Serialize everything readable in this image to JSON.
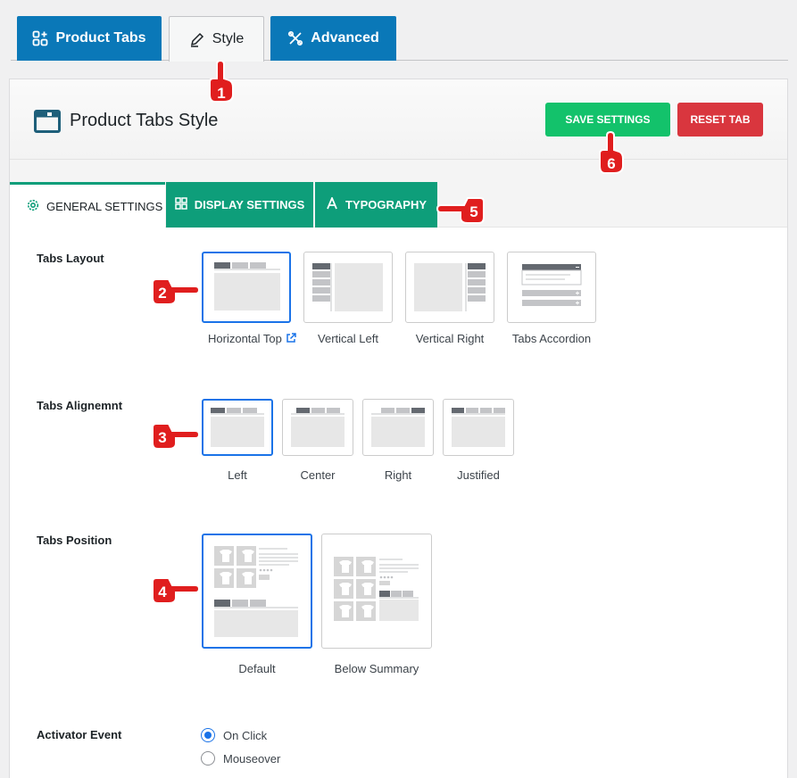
{
  "top_tabs": [
    {
      "label": "Product Tabs",
      "icon": "grid-plus-icon"
    },
    {
      "label": "Style",
      "icon": "pen-icon"
    },
    {
      "label": "Advanced",
      "icon": "tools-icon"
    }
  ],
  "header": {
    "title": "Product Tabs Style",
    "save_label": "SAVE SETTINGS",
    "reset_label": "RESET TAB"
  },
  "sub_tabs": [
    {
      "label": "GENERAL SETTINGS",
      "icon": "gear-icon"
    },
    {
      "label": "DISPLAY SETTINGS",
      "icon": "grid-icon"
    },
    {
      "label": "TYPOGRAPHY",
      "icon": "font-icon"
    }
  ],
  "fields": {
    "layout": {
      "label": "Tabs Layout",
      "options": [
        "Horizontal Top",
        "Vertical Left",
        "Vertical Right",
        "Tabs Accordion"
      ],
      "selected": "Horizontal Top"
    },
    "alignment": {
      "label": "Tabs Alignemnt",
      "options": [
        "Left",
        "Center",
        "Right",
        "Justified"
      ],
      "selected": "Left"
    },
    "position": {
      "label": "Tabs Position",
      "options": [
        "Default",
        "Below Summary"
      ],
      "selected": "Default"
    },
    "activator": {
      "label": "Activator Event",
      "options": [
        "On Click",
        "Mouseover"
      ],
      "selected": "On Click"
    }
  },
  "annotations": [
    "1",
    "2",
    "3",
    "4",
    "5",
    "6"
  ],
  "colors": {
    "blue_tab": "#0a78b8",
    "green_tab": "#0e9e7a",
    "save": "#13c26b",
    "reset": "#d9363e",
    "selected_border": "#1a73e8",
    "marker_red": "#e01e1e"
  }
}
